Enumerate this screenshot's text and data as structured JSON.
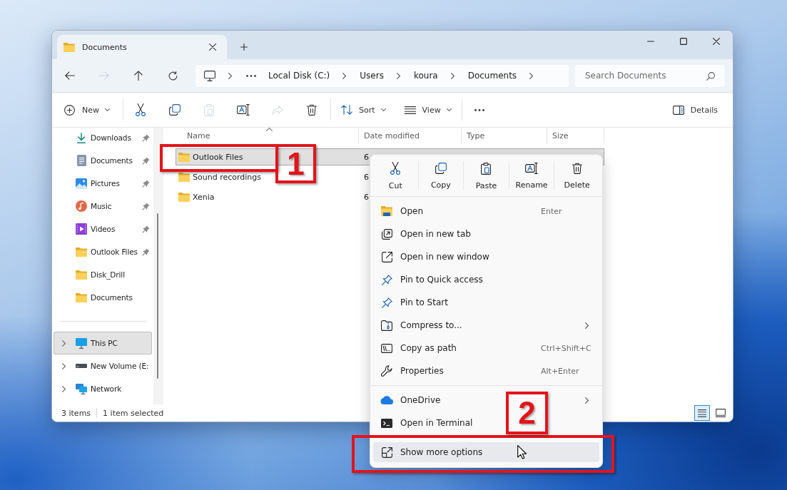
{
  "window": {
    "tabs": [
      {
        "label": "Documents",
        "selected": true
      }
    ],
    "navigation": [
      {
        "kind": "back",
        "disabled": false
      },
      {
        "kind": "forward",
        "disabled": true
      },
      {
        "kind": "up",
        "disabled": false
      },
      {
        "kind": "refresh",
        "disabled": false
      }
    ],
    "address_bar": {
      "segments": [
        "Local Disk (C:)",
        "Users",
        "koura",
        "Documents"
      ]
    },
    "search": {
      "placeholder": "Search Documents"
    }
  },
  "toolbar": {
    "groups": [
      {
        "items": [
          {
            "kind": "new",
            "label": "New",
            "disabled": false
          }
        ]
      },
      {
        "items": [
          {
            "kind": "cut",
            "disabled": false
          },
          {
            "kind": "copy",
            "disabled": false
          },
          {
            "kind": "paste",
            "disabled": true
          },
          {
            "kind": "rename",
            "disabled": false
          },
          {
            "kind": "share",
            "disabled": true
          },
          {
            "kind": "delete",
            "disabled": false
          }
        ]
      },
      {
        "items": [
          {
            "kind": "sort",
            "label": "Sort",
            "disabled": false
          },
          {
            "kind": "view",
            "label": "View",
            "disabled": false
          }
        ]
      },
      {
        "items": [
          {
            "kind": "more",
            "disabled": false
          }
        ]
      }
    ],
    "details": {
      "label": "Details"
    }
  },
  "sidebar": {
    "sections": [
      {
        "items": [
          {
            "kind": "downloads",
            "label": "Downloads",
            "pinned": true,
            "selected": false
          },
          {
            "kind": "documents",
            "label": "Documents",
            "pinned": true,
            "selected": false
          },
          {
            "kind": "pictures",
            "label": "Pictures",
            "pinned": true,
            "selected": false
          },
          {
            "kind": "music",
            "label": "Music",
            "pinned": true,
            "selected": false
          },
          {
            "kind": "videos",
            "label": "Videos",
            "pinned": true,
            "selected": false
          },
          {
            "kind": "folder",
            "label": "Outlook Files",
            "pinned": true,
            "selected": false
          },
          {
            "kind": "folder",
            "label": "Disk_Drill",
            "pinned": false,
            "selected": false
          },
          {
            "kind": "folder",
            "label": "Documents",
            "pinned": false,
            "selected": false
          }
        ]
      },
      {
        "items": [
          {
            "kind": "pc",
            "label": "This PC",
            "expanded": false,
            "selected": true
          },
          {
            "kind": "drive",
            "label": "New Volume (E:",
            "expanded": false,
            "selected": false
          },
          {
            "kind": "network",
            "label": "Network",
            "expanded": false,
            "selected": false
          }
        ]
      }
    ]
  },
  "file_list": {
    "columns": [
      {
        "label": "Name",
        "sorted": true
      },
      {
        "label": "Date modified",
        "sorted": false
      },
      {
        "label": "Type",
        "sorted": false
      },
      {
        "label": "Size",
        "sorted": false
      }
    ],
    "rows": [
      {
        "name": "Outlook Files",
        "date_modified": "6",
        "selected": true
      },
      {
        "name": "Sound recordings",
        "date_modified": "6",
        "selected": false
      },
      {
        "name": "Xenia",
        "date_modified": "6",
        "selected": false
      }
    ]
  },
  "status_bar": {
    "item_count": "3 items",
    "selection": "1 item selected",
    "views": [
      {
        "kind": "details",
        "selected": true
      },
      {
        "kind": "tiles",
        "selected": false
      }
    ]
  },
  "context_menu": {
    "actions": [
      {
        "kind": "cut",
        "label": "Cut"
      },
      {
        "kind": "copy",
        "label": "Copy"
      },
      {
        "kind": "paste",
        "label": "Paste"
      },
      {
        "kind": "rename",
        "label": "Rename"
      },
      {
        "kind": "delete",
        "label": "Delete"
      }
    ],
    "groups": [
      {
        "items": [
          {
            "kind": "open",
            "label": "Open",
            "shortcut": "Enter",
            "submenu": false,
            "highlighted": false
          },
          {
            "kind": "open_tab",
            "label": "Open in new tab",
            "submenu": false,
            "highlighted": false
          },
          {
            "kind": "open_window",
            "label": "Open in new window",
            "submenu": false,
            "highlighted": false
          },
          {
            "kind": "pin",
            "label": "Pin to Quick access",
            "submenu": false,
            "highlighted": false
          },
          {
            "kind": "pin",
            "label": "Pin to Start",
            "submenu": false,
            "highlighted": false
          },
          {
            "kind": "compress",
            "label": "Compress to...",
            "submenu": true,
            "highlighted": false
          },
          {
            "kind": "copy_path",
            "label": "Copy as path",
            "shortcut": "Ctrl+Shift+C",
            "submenu": false,
            "highlighted": false
          },
          {
            "kind": "properties",
            "label": "Properties",
            "shortcut": "Alt+Enter",
            "submenu": false,
            "highlighted": false
          }
        ]
      },
      {
        "items": [
          {
            "kind": "onedrive",
            "label": "OneDrive",
            "submenu": true,
            "highlighted": false
          },
          {
            "kind": "terminal",
            "label": "Open in Terminal",
            "submenu": false,
            "highlighted": false
          }
        ]
      },
      {
        "items": [
          {
            "kind": "more_options",
            "label": "Show more options",
            "submenu": false,
            "highlighted": true
          }
        ]
      }
    ]
  },
  "annotations": [
    {
      "label": "1"
    },
    {
      "label": "2"
    }
  ]
}
